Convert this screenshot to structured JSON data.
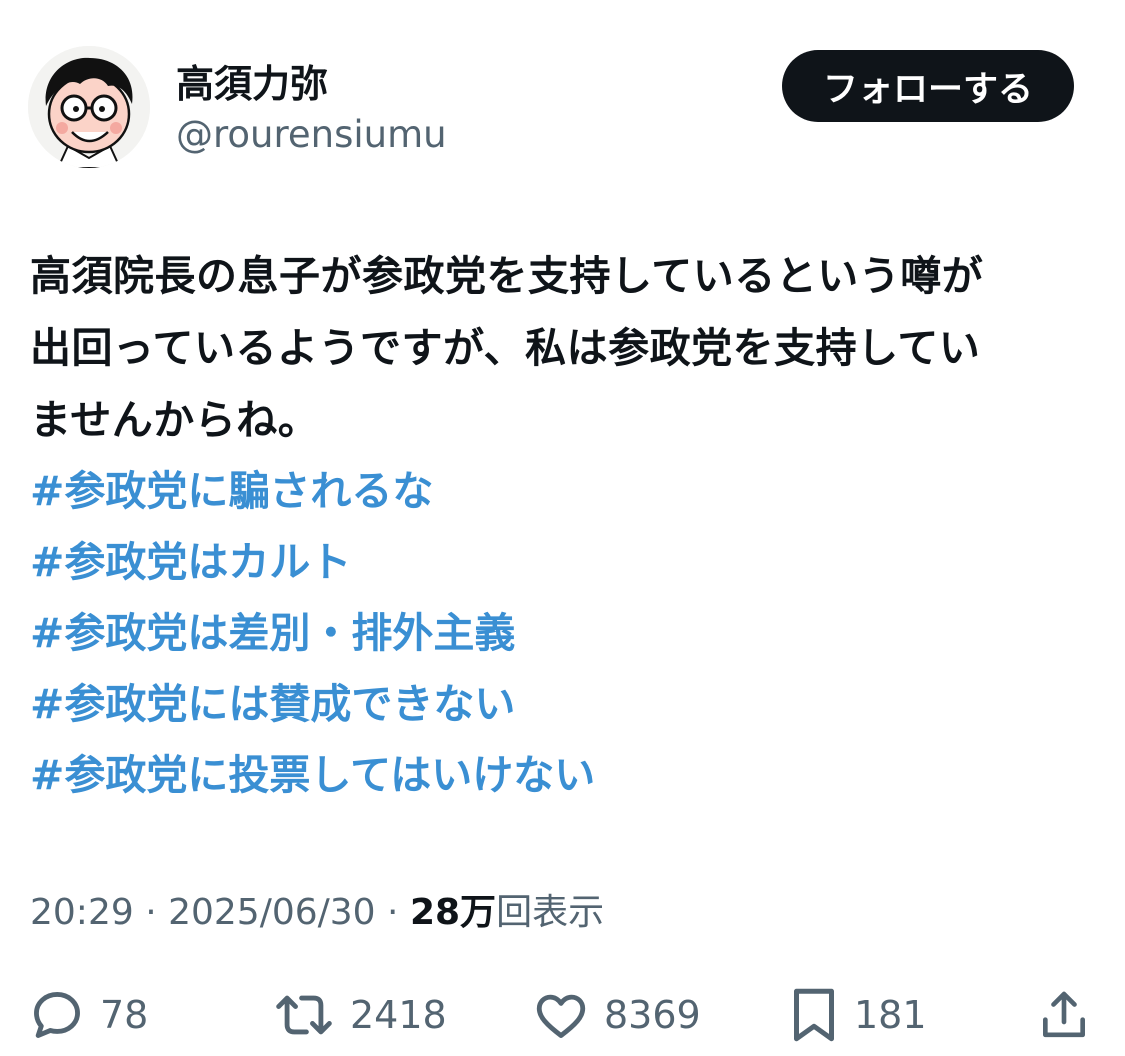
{
  "user": {
    "display_name": "高須力弥",
    "handle": "@rourensiumu",
    "avatar_icon": "cartoon-avatar-icon"
  },
  "follow_button": {
    "label": "フォローする"
  },
  "tweet": {
    "text_lines": [
      "高須院長の息子が参政党を支持しているという噂が",
      "出回っているようですが、私は参政党を支持してい",
      "ませんからね。"
    ],
    "hashtags": [
      "#参政党に騙されるな",
      "#参政党はカルト",
      "#参政党は差別・排外主義",
      "#参政党には賛成できない",
      "#参政党に投票してはいけない"
    ]
  },
  "meta": {
    "time": "20:29",
    "separator": " · ",
    "date": "2025/06/30",
    "views_count": "28",
    "views_unit": "万",
    "views_label": "回表示"
  },
  "actions": {
    "replies": "78",
    "retweets": "2418",
    "likes": "8369",
    "bookmarks": "181"
  },
  "colors": {
    "text": "#0f1419",
    "secondary": "#536471",
    "hashtag": "#3a8fd3",
    "button_bg": "#0f1419",
    "button_text": "#ffffff",
    "background": "#ffffff"
  }
}
